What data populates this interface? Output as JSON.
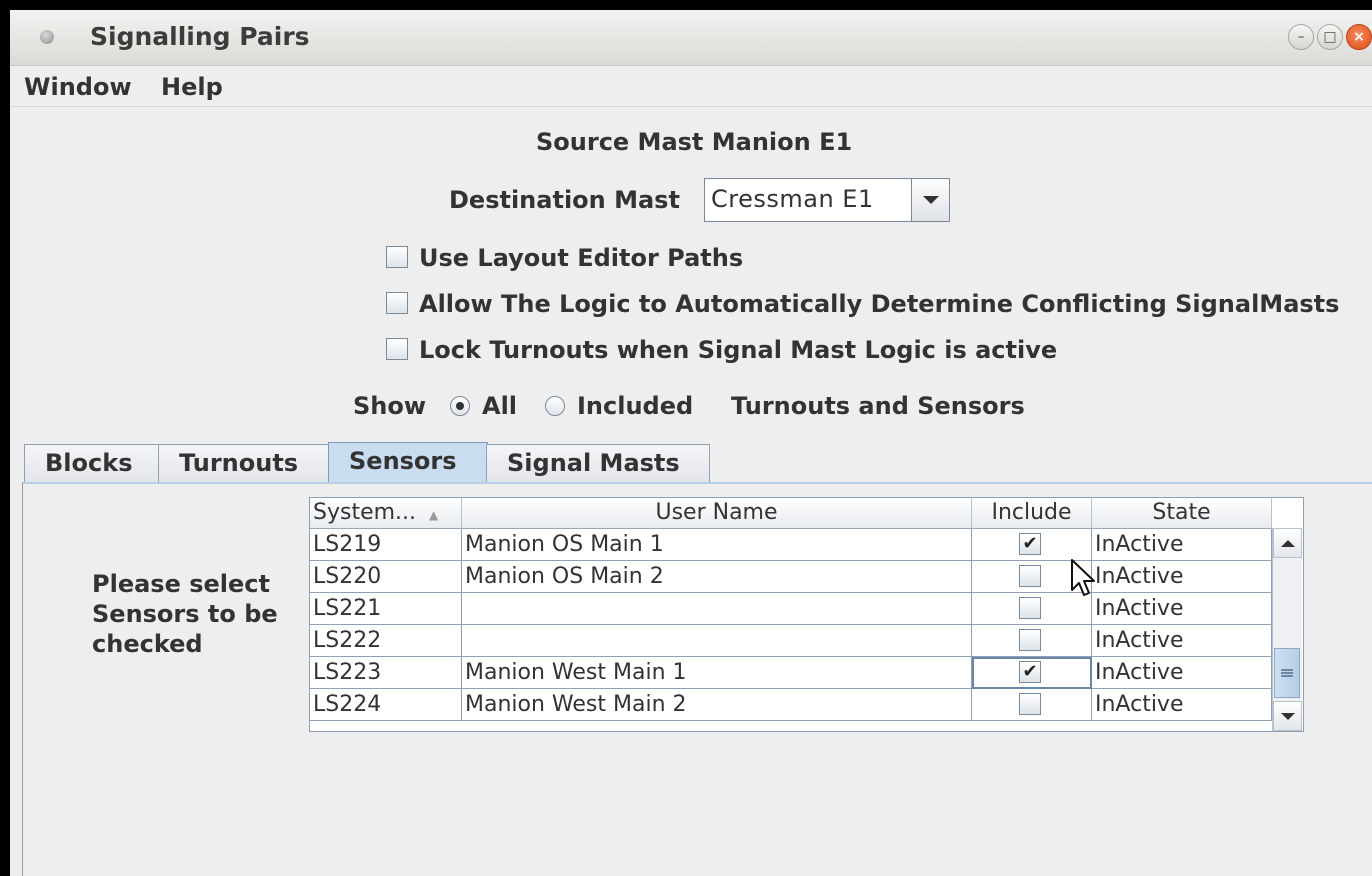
{
  "window": {
    "title": "Signalling Pairs"
  },
  "menu": {
    "items": [
      "Window",
      "Help"
    ]
  },
  "form": {
    "source_mast": "Source Mast Manion E1",
    "destination_label": "Destination Mast",
    "destination_value": "Cressman E1",
    "checkboxes": [
      {
        "label": "Use Layout Editor Paths",
        "checked": false
      },
      {
        "label": "Allow The Logic to Automatically Determine Conflicting SignalMasts",
        "checked": false
      },
      {
        "label": "Lock Turnouts when Signal Mast Logic is active",
        "checked": false
      }
    ],
    "show_label": "Show",
    "radio_all": "All",
    "radio_included": "Included",
    "show_suffix": "Turnouts and Sensors",
    "selected_radio": "All"
  },
  "tabs": {
    "items": [
      "Blocks",
      "Turnouts",
      "Sensors",
      "Signal Masts"
    ],
    "selected": "Sensors"
  },
  "panel": {
    "instruction_lines": [
      "Please select",
      "Sensors to be",
      "checked"
    ]
  },
  "table": {
    "headers": [
      "System...",
      "User Name",
      "Include",
      "State"
    ],
    "sort_indicator": "▲",
    "rows": [
      {
        "system": "LS219",
        "user": "Manion OS Main 1",
        "include": true,
        "state": "InActive"
      },
      {
        "system": "LS220",
        "user": "Manion OS Main 2",
        "include": false,
        "state": "InActive"
      },
      {
        "system": "LS221",
        "user": "",
        "include": false,
        "state": "InActive"
      },
      {
        "system": "LS222",
        "user": "",
        "include": false,
        "state": "InActive"
      },
      {
        "system": "LS223",
        "user": "Manion West Main 1",
        "include": true,
        "state": "InActive"
      },
      {
        "system": "LS224",
        "user": "Manion West Main 2",
        "include": false,
        "state": "InActive"
      }
    ],
    "check_glyph": "✔"
  },
  "colors": {
    "selected_tab": "#c9dcf0",
    "close_button": "#e25a20"
  }
}
